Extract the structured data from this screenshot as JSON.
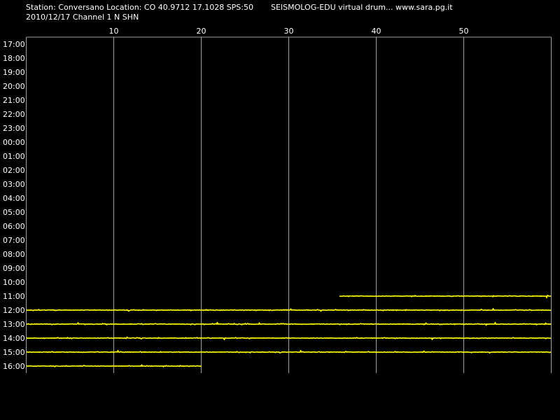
{
  "header": {
    "station_line": "Station: Conversano Location: CO 40.9712 17.1028 SPS:50",
    "date_line": "2010/12/17  Channel 1 N SHN",
    "brand_line": "SEISMOLOG-EDU virtual drum... www.sara.pg.it"
  },
  "colors": {
    "background": "#000000",
    "trace": "#ffff00",
    "grid": "#a0a0a0",
    "text": "#ffffff"
  },
  "chart_data": {
    "type": "line",
    "x_unit": "minutes",
    "xlim": [
      0,
      60
    ],
    "x_ticks": [
      10,
      20,
      30,
      40,
      50
    ],
    "x_tick_labels": [
      "10",
      "20",
      "30",
      "40",
      "50"
    ],
    "grid": true,
    "rows": [
      "17:00",
      "18:00",
      "19:00",
      "20:00",
      "21:00",
      "22:00",
      "23:00",
      "00:00",
      "01:00",
      "02:00",
      "03:00",
      "04:00",
      "05:00",
      "06:00",
      "07:00",
      "08:00",
      "09:00",
      "10:00",
      "11:00",
      "12:00",
      "13:00",
      "14:00",
      "15:00",
      "16:00"
    ],
    "series": [
      {
        "row": "11:00",
        "start_min": 35.8,
        "end_min": 60
      },
      {
        "row": "12:00",
        "start_min": 0,
        "end_min": 60
      },
      {
        "row": "13:00",
        "start_min": 0,
        "end_min": 60
      },
      {
        "row": "14:00",
        "start_min": 0,
        "end_min": 60
      },
      {
        "row": "15:00",
        "start_min": 0,
        "end_min": 60
      },
      {
        "row": "16:00",
        "start_min": 0,
        "end_min": 20
      }
    ]
  }
}
